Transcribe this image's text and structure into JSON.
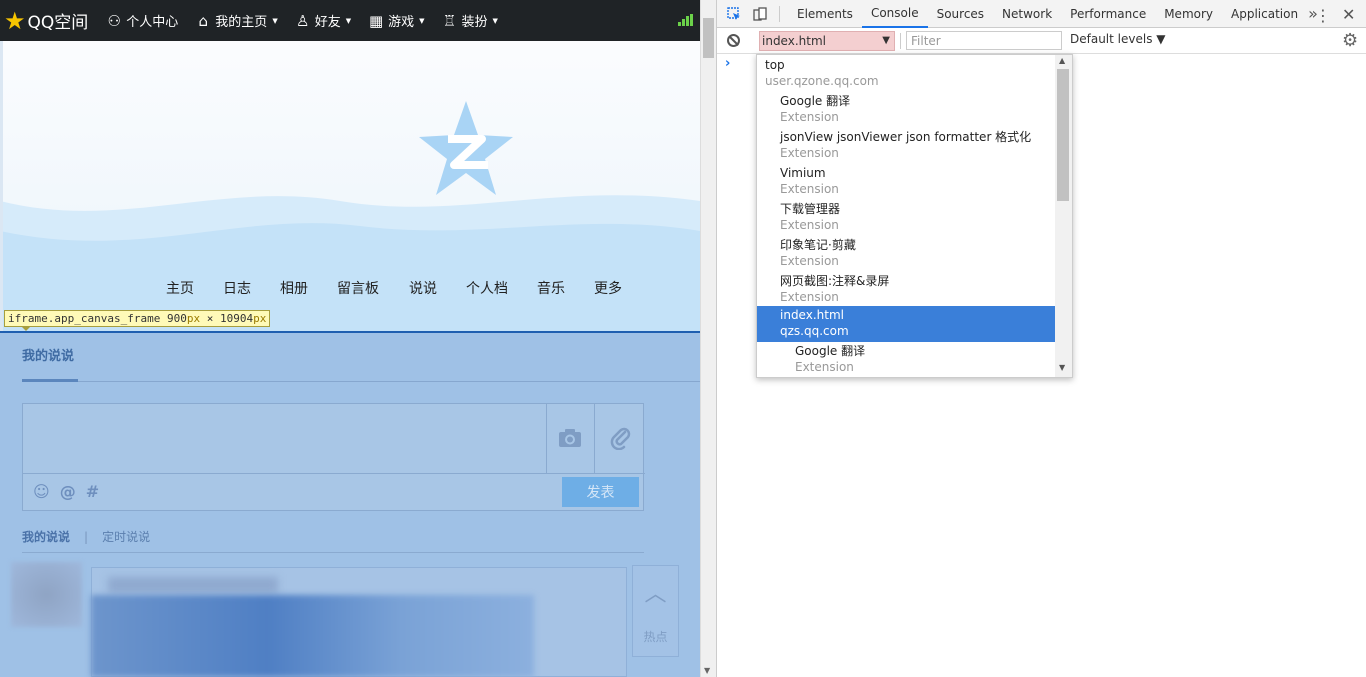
{
  "qzone": {
    "logo_text": "QQ空间",
    "topnav": [
      {
        "icon": "person-icon",
        "label": "个人中心"
      },
      {
        "icon": "home-icon",
        "label": "我的主页"
      },
      {
        "icon": "friends-icon",
        "label": "好友"
      },
      {
        "icon": "grid-icon",
        "label": "游戏"
      },
      {
        "icon": "tshirt-icon",
        "label": "装扮"
      }
    ],
    "page_nav": [
      "主页",
      "日志",
      "相册",
      "留言板",
      "说说",
      "个人档",
      "音乐",
      "更多"
    ],
    "inspect_tooltip": {
      "selector": "iframe.app_canvas_frame",
      "width": "900",
      "unit": "px",
      "times": "×",
      "height": "10904"
    },
    "shuoshuo": {
      "title": "我的说说",
      "post_button": "发表",
      "tools": [
        "☺",
        "@",
        "#"
      ],
      "subtabs": {
        "mine": "我的说说",
        "divider": "|",
        "scheduled": "定时说说"
      },
      "side_hot": "热点"
    }
  },
  "devtools": {
    "tabs": [
      "Elements",
      "Console",
      "Sources",
      "Network",
      "Performance",
      "Memory",
      "Application"
    ],
    "active_tab": "Console",
    "more": "»",
    "context_value": "index.html",
    "filter_placeholder": "Filter",
    "levels_label": "Default levels ▼",
    "prompt": "›",
    "context_menu": [
      {
        "name": "top",
        "sub": "user.qzone.qq.com",
        "indent": 0
      },
      {
        "name": "Google 翻译",
        "sub": "Extension",
        "indent": 1
      },
      {
        "name": "jsonView jsonViewer json formatter 格式化",
        "sub": "Extension",
        "indent": 1
      },
      {
        "name": "Vimium",
        "sub": "Extension",
        "indent": 1
      },
      {
        "name": "下载管理器",
        "sub": "Extension",
        "indent": 1
      },
      {
        "name": "印象笔记·剪藏",
        "sub": "Extension",
        "indent": 1
      },
      {
        "name": "网页截图:注释&录屏",
        "sub": "Extension",
        "indent": 1
      },
      {
        "name": "index.html",
        "sub": "qzs.qq.com",
        "indent": 1,
        "selected": true
      },
      {
        "name": "Google 翻译",
        "sub": "Extension",
        "indent": 2
      }
    ]
  },
  "colors": {
    "qzone_topbar": "#1f2326",
    "highlight_overlay": "#9fc1e6",
    "devtools_accent": "#1a73e8",
    "menu_selected": "#3a7fd9",
    "context_select_bg": "#f4cfd0"
  }
}
